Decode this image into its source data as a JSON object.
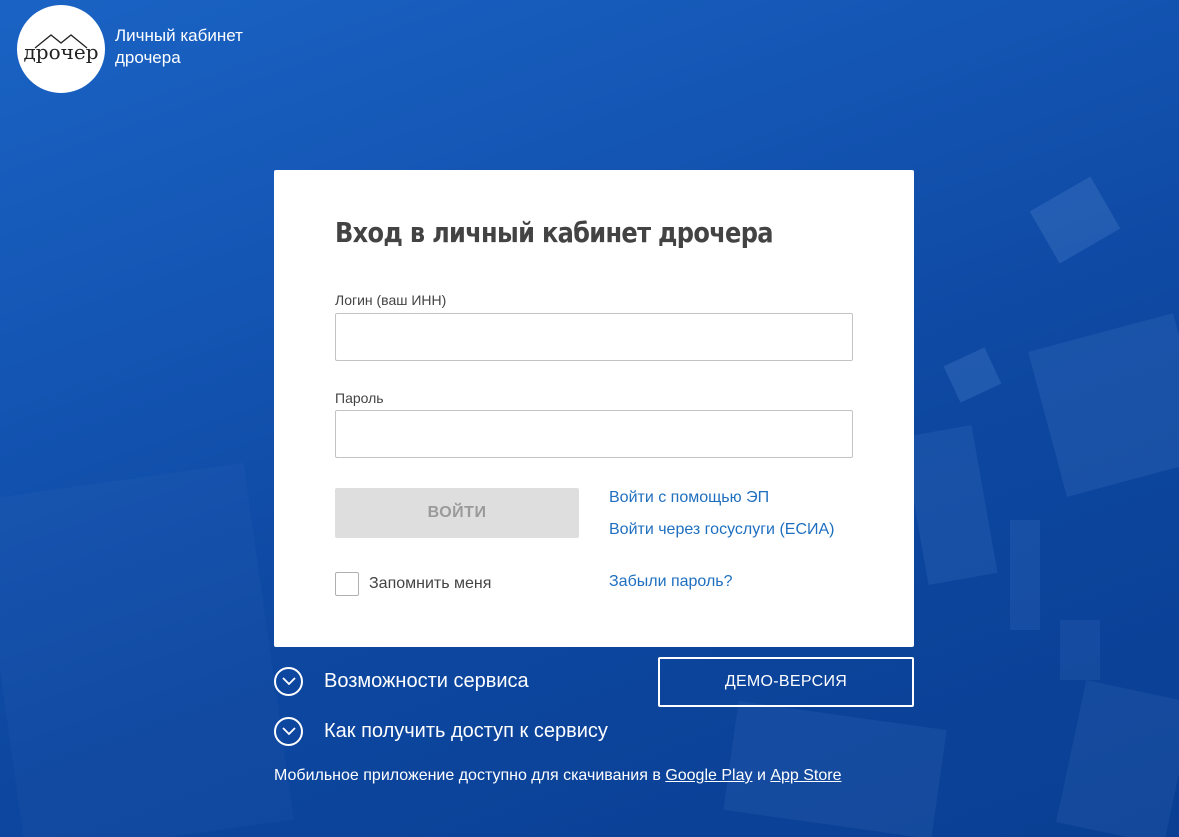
{
  "brand": {
    "logo_text": "дрочер",
    "title_line1": "Личный кабинет",
    "title_line2": "дрочера"
  },
  "login_form": {
    "title": "Вход в личный кабинет дрочера",
    "login_label": "Логин (ваш ИНН)",
    "login_value": "",
    "password_label": "Пароль",
    "password_value": "",
    "submit_label": "ВОЙТИ",
    "ep_link": "Войти с помощью ЭП",
    "esia_link": "Войти через госуслуги (ЕСИА)",
    "remember_label": "Запомнить меня",
    "remember_checked": false,
    "forgot_link": "Забыли пароль?"
  },
  "expanders": {
    "features": "Возможности сервиса",
    "access": "Как получить доступ к сервису"
  },
  "demo_button": "ДЕМО-ВЕРСИЯ",
  "mobile": {
    "text": "Мобильное приложение доступно для скачивания в",
    "google_play": "Google Play",
    "and": "и",
    "app_store": "App Store"
  },
  "icons": {
    "expander": "chevron-down-icon",
    "logo_roof": "roof-icon"
  },
  "colors": {
    "background": "#1455b3",
    "link": "#1f6fbf",
    "button_disabled_bg": "#dedede",
    "button_disabled_text": "#9a9a9a",
    "title": "#434343"
  }
}
